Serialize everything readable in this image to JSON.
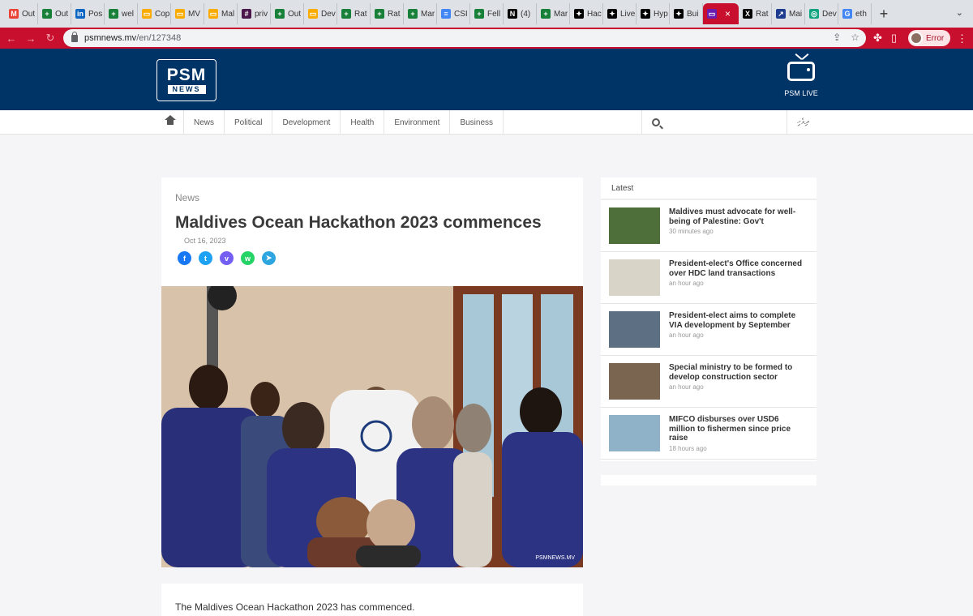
{
  "browser": {
    "tabs": [
      {
        "label": "Out",
        "color": "#ea4335",
        "glyph": "M"
      },
      {
        "label": "Out",
        "color": "#188038",
        "glyph": "+"
      },
      {
        "label": "Pos",
        "color": "#0a66c2",
        "glyph": "in"
      },
      {
        "label": "wel",
        "color": "#188038",
        "glyph": "+"
      },
      {
        "label": "Cop",
        "color": "#f9ab00",
        "glyph": "▭"
      },
      {
        "label": "MV",
        "color": "#f9ab00",
        "glyph": "▭"
      },
      {
        "label": "Mal",
        "color": "#f9ab00",
        "glyph": "▭"
      },
      {
        "label": "priv",
        "color": "#4a154b",
        "glyph": "#"
      },
      {
        "label": "Out",
        "color": "#188038",
        "glyph": "+"
      },
      {
        "label": "Dev",
        "color": "#f9ab00",
        "glyph": "▭"
      },
      {
        "label": "Rat",
        "color": "#188038",
        "glyph": "+"
      },
      {
        "label": "Rat",
        "color": "#188038",
        "glyph": "+"
      },
      {
        "label": "Mar",
        "color": "#188038",
        "glyph": "+"
      },
      {
        "label": "CSI",
        "color": "#4285f4",
        "glyph": "≡"
      },
      {
        "label": "Fell",
        "color": "#188038",
        "glyph": "+"
      },
      {
        "label": "(4)",
        "color": "#000000",
        "glyph": "N"
      },
      {
        "label": "Mar",
        "color": "#188038",
        "glyph": "+"
      },
      {
        "label": "Hac",
        "color": "#000000",
        "glyph": "✦"
      },
      {
        "label": "Live",
        "color": "#000000",
        "glyph": "✦"
      },
      {
        "label": "Hyp",
        "color": "#000000",
        "glyph": "✦"
      },
      {
        "label": "Bui",
        "color": "#000000",
        "glyph": "✦"
      }
    ],
    "active_tab": {
      "glyph": "▭",
      "close": "×"
    },
    "tabs_after": [
      {
        "label": "Rat",
        "color": "#000000",
        "glyph": "X"
      },
      {
        "label": "Mai",
        "color": "#1d3b8f",
        "glyph": "↗"
      },
      {
        "label": "Dev",
        "color": "#10a37f",
        "glyph": "◎"
      },
      {
        "label": "eth",
        "color": "#4285f4",
        "glyph": "G"
      }
    ],
    "new_tab": "+",
    "tab_menu": "⌄",
    "url_host": "psmnews.mv",
    "url_path": "/en/127348",
    "profile_label": "Error",
    "accent": "#c8102e"
  },
  "header": {
    "logo_main": "PSM",
    "logo_sub": "NEWS",
    "live_label": "PSM LIVE",
    "bg": "#003366"
  },
  "nav": {
    "items": [
      "News",
      "Political",
      "Development",
      "Health",
      "Environment",
      "Business"
    ],
    "lang": "ދިވެހި"
  },
  "article": {
    "category": "News",
    "title": "Maldives Ocean Hackathon 2023 commences",
    "date": "Oct 16, 2023",
    "share": [
      {
        "name": "facebook",
        "glyph": "f",
        "color": "#1877f2"
      },
      {
        "name": "twitter",
        "glyph": "t",
        "color": "#1da1f2"
      },
      {
        "name": "viber",
        "glyph": "v",
        "color": "#7360f2"
      },
      {
        "name": "whatsapp",
        "glyph": "w",
        "color": "#25d366"
      },
      {
        "name": "telegram",
        "glyph": "➤",
        "color": "#2ca5e0"
      }
    ],
    "photo_watermark": "PSMNEWS.MV",
    "body_first_line": "The Maldives Ocean Hackathon 2023 has commenced."
  },
  "sidebar": {
    "heading": "Latest",
    "items": [
      {
        "title": "Maldives must advocate for well-being of Palestine: Gov't",
        "time": "30 minutes ago",
        "thumb": "#4e6e3a"
      },
      {
        "title": "President-elect's Office concerned over HDC land transactions",
        "time": "an hour ago",
        "thumb": "#d9d4c8"
      },
      {
        "title": "President-elect aims to complete VIA development by September",
        "time": "an hour ago",
        "thumb": "#5d7083"
      },
      {
        "title": "Special ministry to be formed to develop construction sector",
        "time": "an hour ago",
        "thumb": "#7a6650"
      },
      {
        "title": "MIFCO disburses over USD6 million to fishermen since price raise",
        "time": "18 hours ago",
        "thumb": "#8fb2c8"
      }
    ]
  }
}
